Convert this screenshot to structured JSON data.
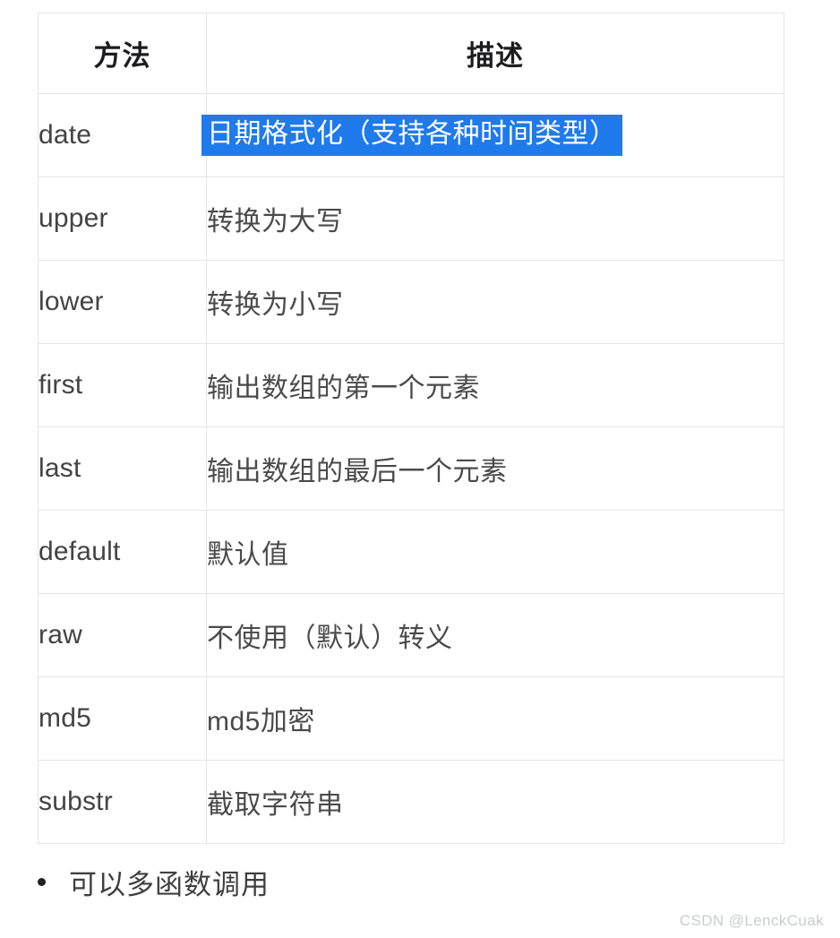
{
  "table": {
    "columns": [
      "方法",
      "描述"
    ],
    "rows": [
      {
        "method": "date",
        "description": "日期格式化（支持各种时间类型）",
        "selected": true
      },
      {
        "method": "upper",
        "description": "转换为大写",
        "selected": false
      },
      {
        "method": "lower",
        "description": "转换为小写",
        "selected": false
      },
      {
        "method": "first",
        "description": "输出数组的第一个元素",
        "selected": false
      },
      {
        "method": "last",
        "description": "输出数组的最后一个元素",
        "selected": false
      },
      {
        "method": "default",
        "description": "默认值",
        "selected": false
      },
      {
        "method": "raw",
        "description": "不使用（默认）转义",
        "selected": false
      },
      {
        "method": "md5",
        "description": "md5加密",
        "selected": false
      },
      {
        "method": "substr",
        "description": "截取字符串",
        "selected": false
      }
    ]
  },
  "notes": [
    {
      "text": "可以多函数调用"
    }
  ],
  "watermark": {
    "text": "CSDN @LenckCuak"
  },
  "colors": {
    "selection_background": "#1f7aec",
    "selection_text": "#ffffff",
    "table_border": "#e3e5e8",
    "body_text": "#4a4a4a",
    "header_text": "#1d1d1f",
    "watermark_text": "#c9ccd1",
    "page_background": "#ffffff"
  }
}
